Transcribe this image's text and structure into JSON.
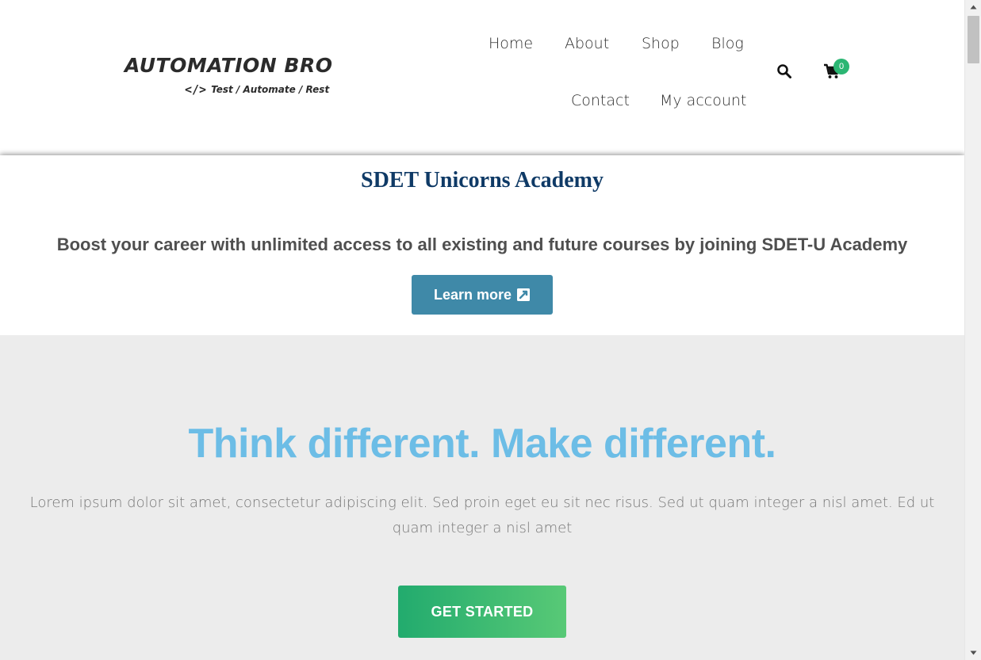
{
  "header": {
    "logo_title": "AUTOMATION BRO",
    "logo_code": "</>",
    "logo_tagline": "Test / Automate / Rest",
    "nav": [
      {
        "label": "Home"
      },
      {
        "label": "About"
      },
      {
        "label": "Shop"
      },
      {
        "label": "Blog"
      },
      {
        "label": "Contact"
      },
      {
        "label": "My account"
      }
    ],
    "cart_count": "0",
    "icons": {
      "search": "search-icon",
      "cart": "cart-icon"
    }
  },
  "promo": {
    "title": "SDET Unicorns Academy",
    "text": "Boost your career with unlimited access to all existing and future courses by joining SDET-U Academy",
    "button_label": "Learn more"
  },
  "hero": {
    "title": "Think different. Make different.",
    "body": "Lorem ipsum dolor sit amet, consectetur adipiscing elit. Sed proin eget eu sit nec risus. Sed ut quam integer a nisl amet.  Ed ut quam integer a nisl amet",
    "button_label": "GET STARTED"
  },
  "colors": {
    "accent_blue": "#6cbde6",
    "promo_title": "#0f3a66",
    "learn_button": "#3f89a8",
    "cta_green_start": "#22ab6e",
    "cta_green_end": "#58c976",
    "badge_green": "#2bb673"
  }
}
